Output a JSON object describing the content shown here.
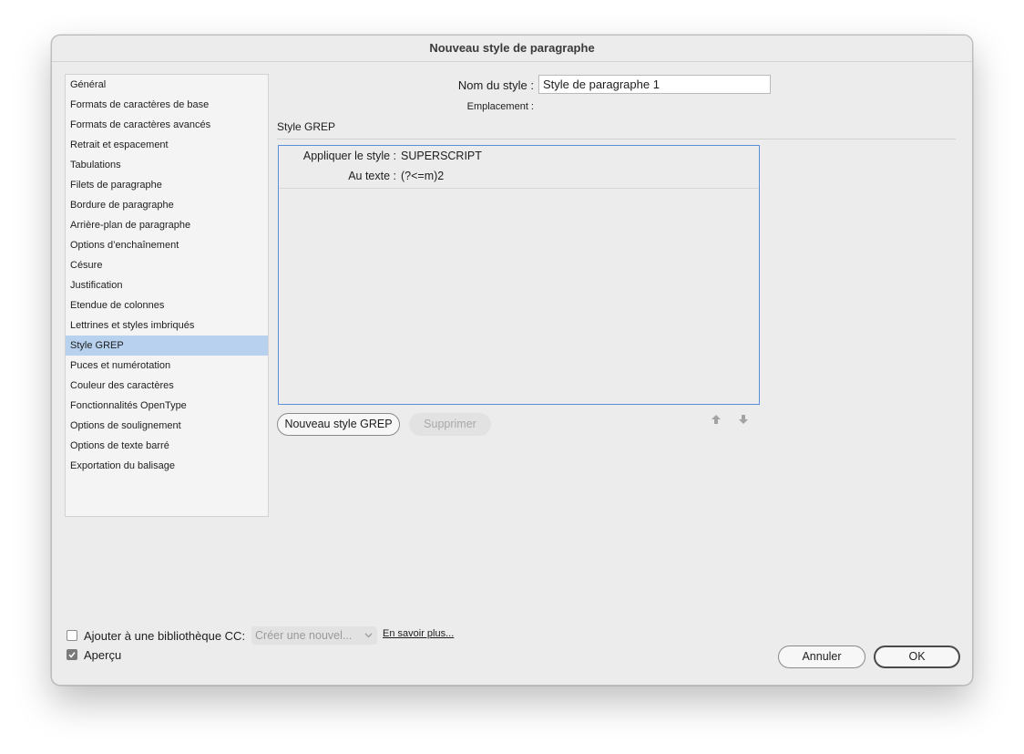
{
  "window": {
    "title": "Nouveau style de paragraphe"
  },
  "sidebar": {
    "items": [
      {
        "label": "Général",
        "selected": false
      },
      {
        "label": "Formats de caractères de base",
        "selected": false
      },
      {
        "label": "Formats de caractères avancés",
        "selected": false
      },
      {
        "label": "Retrait et espacement",
        "selected": false
      },
      {
        "label": "Tabulations",
        "selected": false
      },
      {
        "label": "Filets de paragraphe",
        "selected": false
      },
      {
        "label": "Bordure de paragraphe",
        "selected": false
      },
      {
        "label": "Arrière-plan de paragraphe",
        "selected": false
      },
      {
        "label": "Options d’enchaînement",
        "selected": false
      },
      {
        "label": "Césure",
        "selected": false
      },
      {
        "label": "Justification",
        "selected": false
      },
      {
        "label": "Etendue de colonnes",
        "selected": false
      },
      {
        "label": "Lettrines et styles imbriqués",
        "selected": false
      },
      {
        "label": "Style GREP",
        "selected": true
      },
      {
        "label": "Puces et numérotation",
        "selected": false
      },
      {
        "label": "Couleur des caractères",
        "selected": false
      },
      {
        "label": "Fonctionnalités OpenType",
        "selected": false
      },
      {
        "label": "Options de soulignement",
        "selected": false
      },
      {
        "label": "Options de texte barré",
        "selected": false
      },
      {
        "label": "Exportation du balisage",
        "selected": false
      }
    ]
  },
  "form": {
    "style_name_label": "Nom du style :",
    "style_name_value": "Style de paragraphe 1",
    "location_label": "Emplacement :",
    "section_title": "Style GREP"
  },
  "grep": {
    "rules": [
      {
        "apply_label": "Appliquer le style :",
        "apply_value": "SUPERSCRIPT",
        "text_label": "Au texte :",
        "text_value": "(?<=m)2"
      }
    ],
    "new_button": "Nouveau style GREP",
    "delete_button": "Supprimer",
    "move_up_icon": "arrow-up-icon",
    "move_down_icon": "arrow-down-icon"
  },
  "footer": {
    "cc_library_label": "Ajouter à une bibliothèque CC:",
    "cc_library_checked": false,
    "cc_select_value": "Créer une nouvel...",
    "learn_more": "En savoir plus...",
    "preview_label": "Aperçu",
    "preview_checked": true,
    "cancel_button": "Annuler",
    "ok_button": "OK"
  },
  "colors": {
    "window_bg": "#ececec",
    "selection": "#b7d1ee",
    "list_border": "#5b8fd8"
  }
}
